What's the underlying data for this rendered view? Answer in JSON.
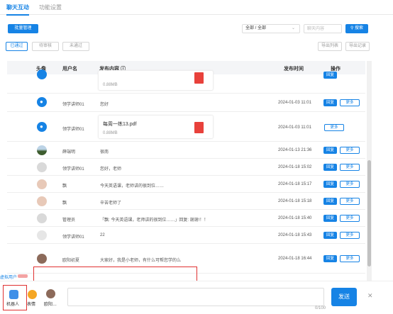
{
  "tabs": [
    "聊天互动",
    "功能设置"
  ],
  "toolbar": {
    "batch_label": "批量管理",
    "select_value": "全部 / 全部",
    "search_placeholder": "聊天内容",
    "search_label": "搜索"
  },
  "filters": [
    "已通过",
    "待审核",
    "未通过"
  ],
  "exports": [
    "导出列表",
    "导出记录"
  ],
  "table": {
    "headers": [
      "头像",
      "用户名",
      "发布内容",
      "发布时间",
      "操作"
    ]
  },
  "rows": [
    {
      "user": "",
      "content": "",
      "file_name": "",
      "file_size": "0.88MB",
      "time": "",
      "actions": [
        "回复"
      ]
    },
    {
      "user": "领学讲师01",
      "content": "您好",
      "time": "2024-01-03 11:01",
      "actions": [
        "回复",
        "更多"
      ]
    },
    {
      "user": "领学讲师01",
      "content": "",
      "file_name": "每周一练13.pdf",
      "file_size": "0.88MB",
      "time": "2024-01-03 11:01",
      "actions": [
        "更多"
      ]
    },
    {
      "user": "薛端明",
      "content": "很南",
      "time": "2024-01-13 21:36",
      "actions": [
        "回复",
        "更多"
      ]
    },
    {
      "user": "领学讲师01",
      "content": "您好，老师",
      "time": "2024-01-18 15:02",
      "actions": [
        "回复",
        "更多"
      ]
    },
    {
      "user": "飘",
      "content": "今天英语课，老师讲的很到位……",
      "time": "2024-01-18 15:17",
      "actions": [
        "回复",
        "更多"
      ]
    },
    {
      "user": "飘",
      "content": "辛苦老师了",
      "time": "2024-01-18 15:18",
      "actions": [
        "回复",
        "更多"
      ]
    },
    {
      "user": "管理员",
      "content": "「飘: 今天英语课，老师讲的很到位……」回复: 谢谢!！！",
      "time": "2024-01-18 15:40",
      "actions": [
        "回复",
        "更多"
      ]
    },
    {
      "user": "领学讲师01",
      "content": "22",
      "time": "2024-01-18 15:43",
      "actions": [
        "回复",
        "更多"
      ]
    },
    {
      "user": "欧阳初夏",
      "content": "大家好，我是小老师，有什么可帮您学的么",
      "time": "2024-01-18 16:44",
      "actions": [
        "回复",
        "更多"
      ]
    }
  ],
  "virtual_user": {
    "label": "虚拟用户"
  },
  "bottom": {
    "items": [
      "机器人",
      "表情",
      "欧阳…"
    ],
    "send_label": "发送",
    "counter": "0/100",
    "close": "✕"
  },
  "icons": {
    "info": "ⓘ",
    "chevron": "⌄",
    "pdf": "pdf-icon"
  },
  "colors": {
    "accent": "#1683e5",
    "highlight": "#e03131",
    "pdf": "#e8413b"
  }
}
